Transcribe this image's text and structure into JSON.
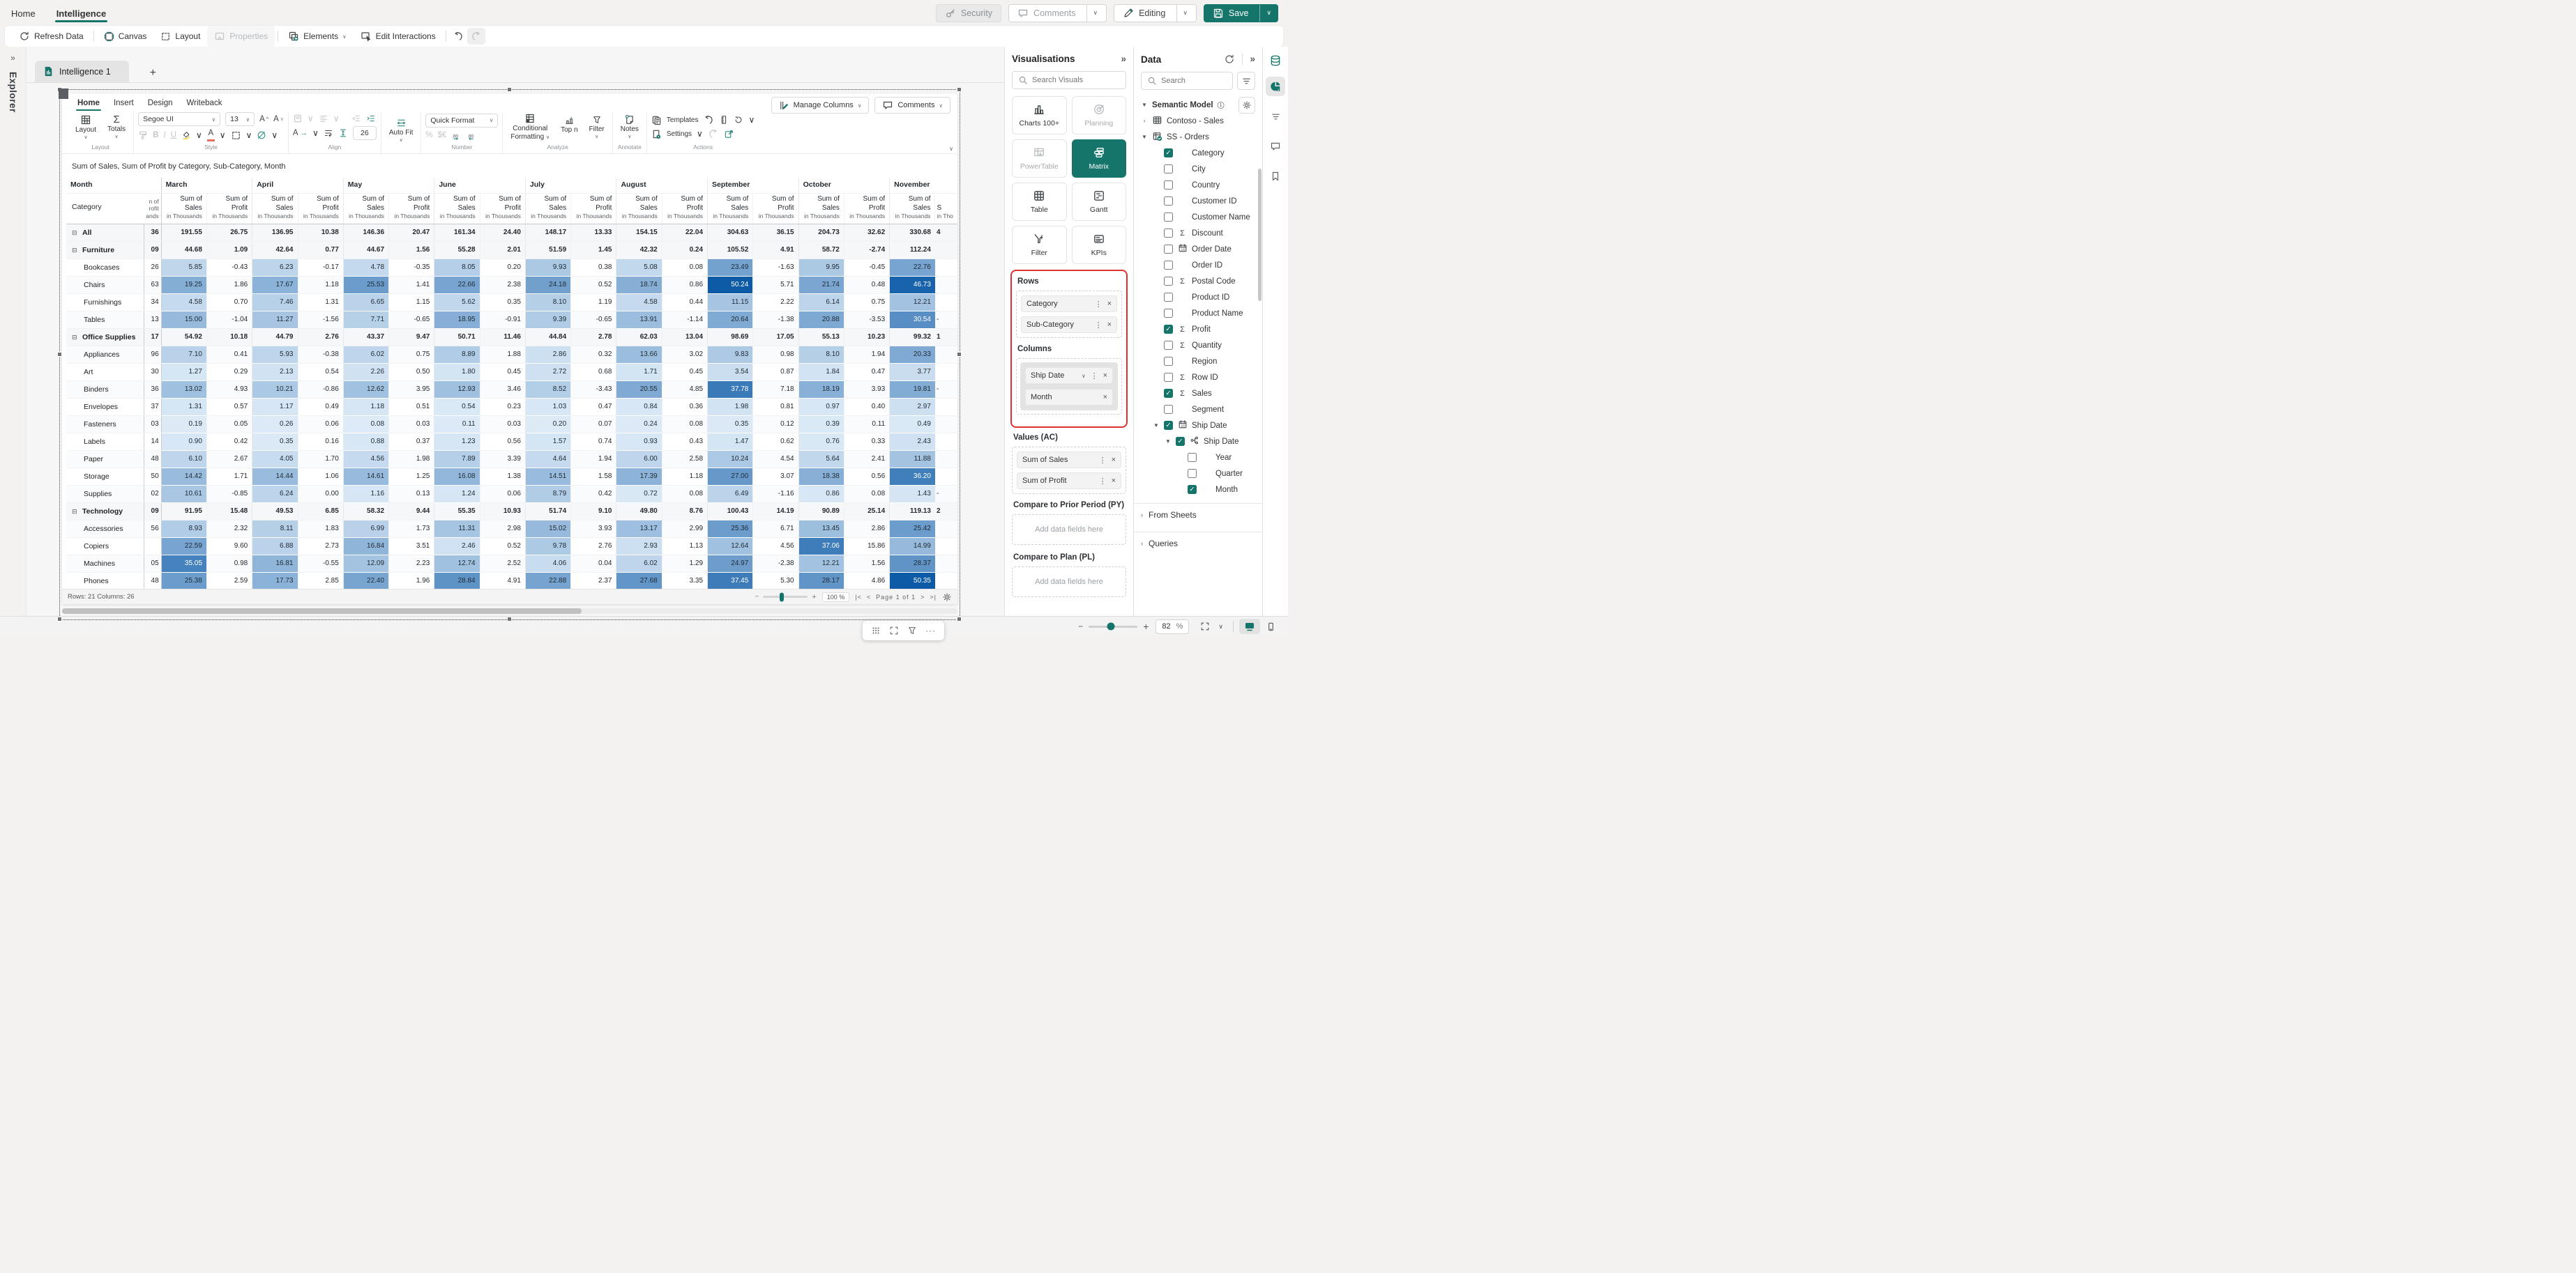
{
  "colors": {
    "accent": "#15756a",
    "heat_low": "#dcebf7",
    "heat_high": "#0d5aa7",
    "selection_red": "#e03131"
  },
  "appbar": {
    "tabs": [
      "Home",
      "Intelligence"
    ],
    "active_tab": "Intelligence",
    "security": "Security",
    "comments": "Comments",
    "editing": "Editing",
    "save": "Save"
  },
  "cmdbar": {
    "refresh": "Refresh Data",
    "canvas": "Canvas",
    "layout": "Layout",
    "properties": "Properties",
    "elements": "Elements",
    "edit_interactions": "Edit Interactions"
  },
  "explorer_label": "Explorer",
  "sheet_tab": "Intelligence 1",
  "ribbon": {
    "tabs": [
      "Home",
      "Insert",
      "Design",
      "Writeback"
    ],
    "active_tab": "Home",
    "layout_btn": "Layout",
    "totals_btn": "Totals",
    "font": "Segoe UI",
    "font_size": "13",
    "row_height": "26",
    "auto_fit": "Auto Fit",
    "quick_format": "Quick Format",
    "cond_format_1": "Conditional",
    "cond_format_2": "Formatting",
    "cf_badge": "1",
    "top_n": "Top n",
    "filter": "Filter",
    "notes": "Notes",
    "templates": "Templates",
    "settings": "Settings",
    "manage_columns": "Manage Columns",
    "comments": "Comments",
    "captions": {
      "layout": "Layout",
      "style": "Style",
      "align": "Align",
      "number": "Number",
      "analyze": "Analyze",
      "annotate": "Annotate",
      "actions": "Actions"
    }
  },
  "matrix": {
    "title": "Sum of Sales, Sum of Profit by Category, Sub-Category, Month",
    "corner_top": "Month",
    "corner_bottom": "Category",
    "months": [
      "March",
      "April",
      "May",
      "June",
      "July",
      "August",
      "September",
      "October",
      "November"
    ],
    "sales_header": [
      "Sum of",
      "Sales",
      "in Thousands"
    ],
    "profit_header": [
      "Sum of",
      "Profit",
      "in Thousands"
    ],
    "clip_left_header": [
      "n of",
      "rofit",
      "ands"
    ],
    "clip_right_header": [
      "S",
      "in Tho"
    ],
    "rows": [
      {
        "label": "All",
        "group": true,
        "feb": "36",
        "clip": "4",
        "values": [
          191.55,
          26.75,
          136.95,
          10.38,
          146.36,
          20.47,
          161.34,
          24.4,
          148.17,
          13.33,
          154.15,
          22.04,
          304.63,
          36.15,
          204.73,
          32.62,
          330.68
        ]
      },
      {
        "label": "Furniture",
        "group": true,
        "feb": "09",
        "clip": "",
        "values": [
          44.68,
          1.09,
          42.64,
          0.77,
          44.67,
          1.56,
          55.28,
          2.01,
          51.59,
          1.45,
          42.32,
          0.24,
          105.52,
          4.91,
          58.72,
          -2.74,
          112.24
        ]
      },
      {
        "label": "Bookcases",
        "group": false,
        "feb": "26",
        "clip": "",
        "values": [
          5.85,
          -0.43,
          6.23,
          -0.17,
          4.78,
          -0.35,
          8.05,
          0.2,
          9.93,
          0.38,
          5.08,
          0.08,
          23.49,
          -1.63,
          9.95,
          -0.45,
          22.76
        ]
      },
      {
        "label": "Chairs",
        "group": false,
        "feb": "63",
        "clip": "",
        "values": [
          19.25,
          1.86,
          17.67,
          1.18,
          25.53,
          1.41,
          22.66,
          2.38,
          24.18,
          0.52,
          18.74,
          0.86,
          50.24,
          5.71,
          21.74,
          0.48,
          46.73
        ]
      },
      {
        "label": "Furnishings",
        "group": false,
        "feb": "34",
        "clip": "",
        "values": [
          4.58,
          0.7,
          7.46,
          1.31,
          6.65,
          1.15,
          5.62,
          0.35,
          8.1,
          1.19,
          4.58,
          0.44,
          11.15,
          2.22,
          6.14,
          0.75,
          12.21
        ]
      },
      {
        "label": "Tables",
        "group": false,
        "feb": "13",
        "clip": "-",
        "values": [
          15.0,
          -1.04,
          11.27,
          -1.56,
          7.71,
          -0.65,
          18.95,
          -0.91,
          9.39,
          -0.65,
          13.91,
          -1.14,
          20.64,
          -1.38,
          20.88,
          -3.53,
          30.54
        ]
      },
      {
        "label": "Office Supplies",
        "group": true,
        "feb": "17",
        "clip": "1",
        "values": [
          54.92,
          10.18,
          44.79,
          2.76,
          43.37,
          9.47,
          50.71,
          11.46,
          44.84,
          2.78,
          62.03,
          13.04,
          98.69,
          17.05,
          55.13,
          10.23,
          99.32
        ]
      },
      {
        "label": "Appliances",
        "group": false,
        "feb": "96",
        "clip": "",
        "values": [
          7.1,
          0.41,
          5.93,
          -0.38,
          6.02,
          0.75,
          8.89,
          1.88,
          2.86,
          0.32,
          13.66,
          3.02,
          9.83,
          0.98,
          8.1,
          1.94,
          20.33
        ]
      },
      {
        "label": "Art",
        "group": false,
        "feb": "30",
        "clip": "",
        "values": [
          1.27,
          0.29,
          2.13,
          0.54,
          2.26,
          0.5,
          1.8,
          0.45,
          2.72,
          0.68,
          1.71,
          0.45,
          3.54,
          0.87,
          1.84,
          0.47,
          3.77
        ]
      },
      {
        "label": "Binders",
        "group": false,
        "feb": "36",
        "clip": "-",
        "values": [
          13.02,
          4.93,
          10.21,
          -0.86,
          12.62,
          3.95,
          12.93,
          3.46,
          8.52,
          -3.43,
          20.55,
          4.85,
          37.78,
          7.18,
          18.19,
          3.93,
          19.81
        ]
      },
      {
        "label": "Envelopes",
        "group": false,
        "feb": "37",
        "clip": "",
        "values": [
          1.31,
          0.57,
          1.17,
          0.49,
          1.18,
          0.51,
          0.54,
          0.23,
          1.03,
          0.47,
          0.84,
          0.36,
          1.98,
          0.81,
          0.97,
          0.4,
          2.97
        ]
      },
      {
        "label": "Fasteners",
        "group": false,
        "feb": "03",
        "clip": "",
        "values": [
          0.19,
          0.05,
          0.26,
          0.06,
          0.08,
          0.03,
          0.11,
          0.03,
          0.2,
          0.07,
          0.24,
          0.08,
          0.35,
          0.12,
          0.39,
          0.11,
          0.49
        ]
      },
      {
        "label": "Labels",
        "group": false,
        "feb": "14",
        "clip": "",
        "values": [
          0.9,
          0.42,
          0.35,
          0.16,
          0.88,
          0.37,
          1.23,
          0.56,
          1.57,
          0.74,
          0.93,
          0.43,
          1.47,
          0.62,
          0.76,
          0.33,
          2.43
        ]
      },
      {
        "label": "Paper",
        "group": false,
        "feb": "48",
        "clip": "",
        "values": [
          6.1,
          2.67,
          4.05,
          1.7,
          4.56,
          1.98,
          7.89,
          3.39,
          4.64,
          1.94,
          6.0,
          2.58,
          10.24,
          4.54,
          5.64,
          2.41,
          11.88
        ]
      },
      {
        "label": "Storage",
        "group": false,
        "feb": "50",
        "clip": "",
        "values": [
          14.42,
          1.71,
          14.44,
          1.06,
          14.61,
          1.25,
          16.08,
          1.38,
          14.51,
          1.58,
          17.39,
          1.18,
          27.0,
          3.07,
          18.38,
          0.56,
          36.2
        ]
      },
      {
        "label": "Supplies",
        "group": false,
        "feb": "02",
        "clip": "-",
        "values": [
          10.61,
          -0.85,
          6.24,
          0.0,
          1.16,
          0.13,
          1.24,
          0.06,
          8.79,
          0.42,
          0.72,
          0.08,
          6.49,
          -1.16,
          0.86,
          0.08,
          1.43
        ]
      },
      {
        "label": "Technology",
        "group": true,
        "feb": "09",
        "clip": "2",
        "values": [
          91.95,
          15.48,
          49.53,
          6.85,
          58.32,
          9.44,
          55.35,
          10.93,
          51.74,
          9.1,
          49.8,
          8.76,
          100.43,
          14.19,
          90.89,
          25.14,
          119.13
        ]
      },
      {
        "label": "Accessories",
        "group": false,
        "feb": "56",
        "clip": "",
        "values": [
          8.93,
          2.32,
          8.11,
          1.83,
          6.99,
          1.73,
          11.31,
          2.98,
          15.02,
          3.93,
          13.17,
          2.99,
          25.36,
          6.71,
          13.45,
          2.86,
          25.42
        ]
      },
      {
        "label": "Copiers",
        "group": false,
        "feb": "",
        "clip": "",
        "values": [
          22.59,
          9.6,
          6.88,
          2.73,
          16.84,
          3.51,
          2.46,
          0.52,
          9.78,
          2.76,
          2.93,
          1.13,
          12.64,
          4.56,
          37.06,
          15.86,
          14.99
        ]
      },
      {
        "label": "Machines",
        "group": false,
        "feb": "05",
        "clip": "",
        "values": [
          35.05,
          0.98,
          16.81,
          -0.55,
          12.09,
          2.23,
          12.74,
          2.52,
          4.06,
          0.04,
          6.02,
          1.29,
          24.97,
          -2.38,
          12.21,
          1.56,
          28.37
        ]
      },
      {
        "label": "Phones",
        "group": false,
        "feb": "48",
        "clip": "",
        "values": [
          25.38,
          2.59,
          17.73,
          2.85,
          22.4,
          1.96,
          28.84,
          4.91,
          22.88,
          2.37,
          27.68,
          3.35,
          37.45,
          5.3,
          28.17,
          4.86,
          50.35
        ]
      }
    ],
    "footer": {
      "rows_cols": "Rows: 21 Columns: 26",
      "zoom": "100 %",
      "page": "Page 1 of 1"
    }
  },
  "visualisations": {
    "title": "Visualisations",
    "search_placeholder": "Search Visuals",
    "tiles": [
      {
        "label": "Charts 100+",
        "icon": "barchart",
        "state": "normal"
      },
      {
        "label": "Planning",
        "icon": "target",
        "state": "disabled"
      },
      {
        "label": "PowerTable",
        "icon": "powertable",
        "state": "disabled"
      },
      {
        "label": "Matrix",
        "icon": "matrix",
        "state": "selected"
      },
      {
        "label": "Table",
        "icon": "table",
        "state": "normal"
      },
      {
        "label": "Gantt",
        "icon": "gantt",
        "state": "normal"
      },
      {
        "label": "Filter",
        "icon": "funnelbolt",
        "state": "normal"
      },
      {
        "label": "KPIs",
        "icon": "kpi",
        "state": "normal"
      }
    ],
    "rows_label": "Rows",
    "rows_pills": [
      "Category",
      "Sub-Category"
    ],
    "columns_label": "Columns",
    "columns_pills": [
      "Ship Date",
      "Month"
    ],
    "values_label": "Values (AC)",
    "values_pills": [
      "Sum of Sales",
      "Sum of Profit"
    ],
    "py_label": "Compare to Prior Period (PY)",
    "py_placeholder": "Add data fields here",
    "pl_label": "Compare to Plan (PL)",
    "pl_placeholder": "Add data fields here"
  },
  "data_panel": {
    "title": "Data",
    "search_placeholder": "Search",
    "root": "Semantic Model",
    "fields": [
      {
        "label": "Contoso - Sales",
        "caret": ">",
        "icon": "grid",
        "checked": null,
        "indent": 0
      },
      {
        "label": "SS - Orders",
        "caret": "v",
        "icon": "gridcheck",
        "checked": null,
        "indent": 0
      },
      {
        "label": "Category",
        "caret": "",
        "icon": "none",
        "checked": true,
        "indent": 1
      },
      {
        "label": "City",
        "caret": "",
        "icon": "none",
        "checked": false,
        "indent": 1
      },
      {
        "label": "Country",
        "caret": "",
        "icon": "none",
        "checked": false,
        "indent": 1
      },
      {
        "label": "Customer ID",
        "caret": "",
        "icon": "none",
        "checked": false,
        "indent": 1
      },
      {
        "label": "Customer Name",
        "caret": "",
        "icon": "none",
        "checked": false,
        "indent": 1
      },
      {
        "label": "Discount",
        "caret": "",
        "icon": "sum",
        "checked": false,
        "indent": 1
      },
      {
        "label": "Order Date",
        "caret": "",
        "icon": "cal",
        "checked": false,
        "indent": 1
      },
      {
        "label": "Order ID",
        "caret": "",
        "icon": "none",
        "checked": false,
        "indent": 1
      },
      {
        "label": "Postal Code",
        "caret": "",
        "icon": "sum",
        "checked": false,
        "indent": 1
      },
      {
        "label": "Product ID",
        "caret": "",
        "icon": "none",
        "checked": false,
        "indent": 1
      },
      {
        "label": "Product Name",
        "caret": "",
        "icon": "none",
        "checked": false,
        "indent": 1
      },
      {
        "label": "Profit",
        "caret": "",
        "icon": "sum",
        "checked": true,
        "indent": 1
      },
      {
        "label": "Quantity",
        "caret": "",
        "icon": "sum",
        "checked": false,
        "indent": 1
      },
      {
        "label": "Region",
        "caret": "",
        "icon": "none",
        "checked": false,
        "indent": 1
      },
      {
        "label": "Row ID",
        "caret": "",
        "icon": "sum",
        "checked": false,
        "indent": 1
      },
      {
        "label": "Sales",
        "caret": "",
        "icon": "sum",
        "checked": true,
        "indent": 1
      },
      {
        "label": "Segment",
        "caret": "",
        "icon": "none",
        "checked": false,
        "indent": 1
      },
      {
        "label": "Ship Date",
        "caret": "v",
        "icon": "cal",
        "checked": true,
        "indent": 1
      },
      {
        "label": "Ship Date",
        "caret": "v",
        "icon": "hier",
        "checked": true,
        "indent": 2
      },
      {
        "label": "Year",
        "caret": "",
        "icon": "none",
        "checked": false,
        "indent": 3
      },
      {
        "label": "Quarter",
        "caret": "",
        "icon": "none",
        "checked": false,
        "indent": 3
      },
      {
        "label": "Month",
        "caret": "",
        "icon": "none",
        "checked": true,
        "indent": 3
      }
    ],
    "from_sheets": "From Sheets",
    "queries": "Queries"
  },
  "bottombar": {
    "zoom_value": "82",
    "percent": "%"
  }
}
